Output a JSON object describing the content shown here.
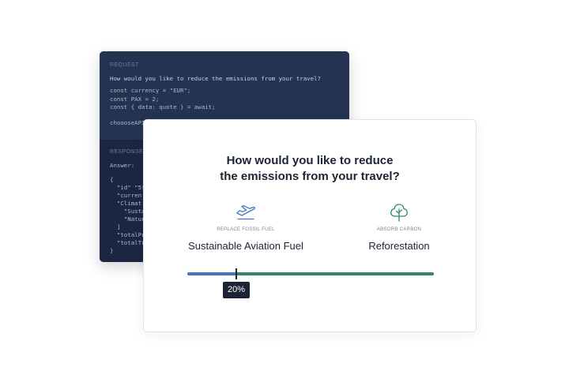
{
  "code_panel": {
    "request_heading": "REQUEST",
    "request_lines": [
      "How would you like to reduce the emissions from your travel?",
      "const currency = \"EUR\";",
      "const PAX = 2;",
      "const { data: quote } = await;",
      "",
      "choooseAPI"
    ],
    "response_heading": "RESPONSE",
    "response_lines": [
      "Answer:",
      "",
      "{",
      "  \"id\" \"5f",
      "  \"curren",
      "  \"Climat",
      "    \"Susta",
      "    \"Natur",
      "  ]",
      "  \"totalPr",
      "  \"totalTr",
      "}"
    ]
  },
  "card": {
    "title_line1": "How would you like to reduce",
    "title_line2": "the emissions from your travel?",
    "left_option": {
      "icon": "airplane-icon",
      "caption": "REPLACE FOSSIL FUEL",
      "label": "Sustainable Aviation Fuel"
    },
    "right_option": {
      "icon": "tree-icon",
      "caption": "ABSORB CARBON",
      "label": "Reforestation"
    },
    "slider": {
      "value_fraction": 0.2,
      "value_label": "20%"
    }
  },
  "colors": {
    "code_bg_request": "#243352",
    "code_bg_response": "#1d2640",
    "slider_left": "#3d79c2",
    "slider_right": "#2c8a6b",
    "text_dark": "#1c2333",
    "icon_blue": "#3d79c2",
    "icon_green": "#2c8a6b"
  }
}
